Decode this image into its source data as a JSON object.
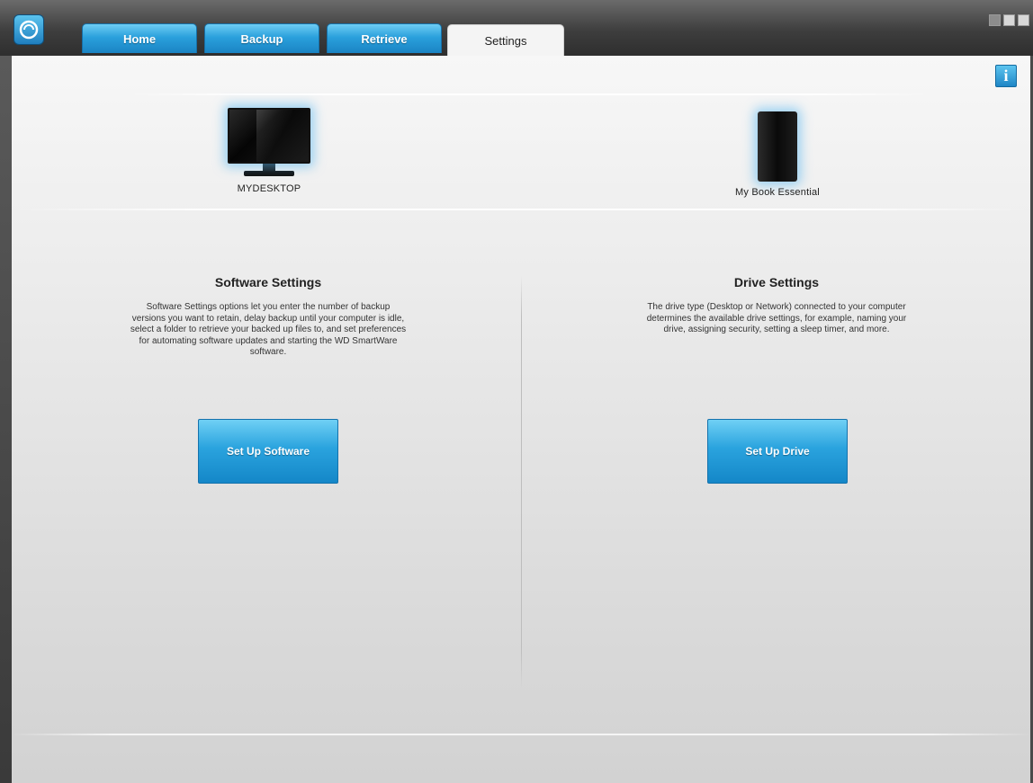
{
  "tabs": [
    {
      "label": "Home"
    },
    {
      "label": "Backup"
    },
    {
      "label": "Retrieve"
    },
    {
      "label": "Settings",
      "active": true
    }
  ],
  "info_button": {
    "label": "i"
  },
  "devices": {
    "computer": {
      "label": "MYDESKTOP",
      "icon": "monitor-icon"
    },
    "drive": {
      "label": "My Book Essential",
      "icon": "external-drive-icon"
    }
  },
  "software_settings": {
    "title": "Software Settings",
    "description": "Software Settings options let you enter the number of backup versions you want to retain, delay backup until your computer is idle, select a folder to retrieve your backed up files to, and set preferences for automating software updates and starting the WD SmartWare software.",
    "button_label": "Set Up Software"
  },
  "drive_settings": {
    "title": "Drive Settings",
    "description": "The drive type (Desktop or Network) connected to your computer determines the available drive settings, for example, naming your drive, assigning security, setting a sleep timer, and more.",
    "button_label": "Set Up Drive"
  },
  "colors": {
    "accent_blue": "#2aa0dc",
    "titlebar_dark": "#3e3e3e",
    "content_bg": "#ececec"
  }
}
